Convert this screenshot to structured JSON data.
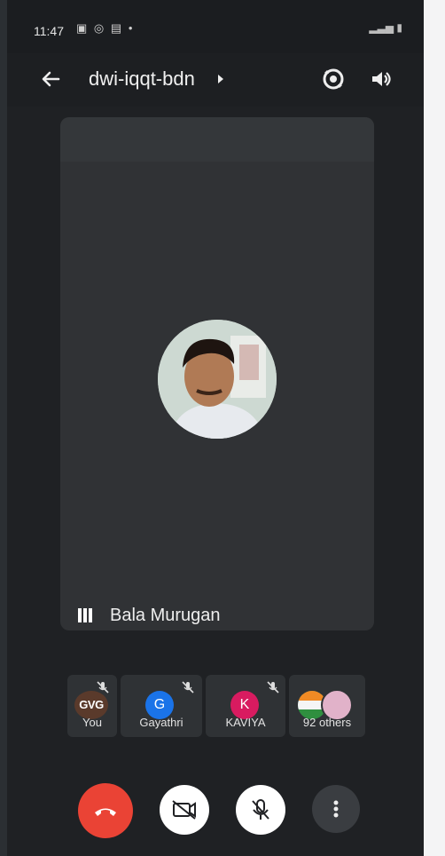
{
  "status_bar": {
    "time": "11:47",
    "dot": "•"
  },
  "app_bar": {
    "meeting_code": "dwi-iqqt-bdn"
  },
  "main_tile": {
    "name": "Bala Murugan"
  },
  "participants": [
    {
      "label": "You",
      "avatar": "GVG",
      "avatar_color": "#5a3a2b"
    },
    {
      "label": "Gayathri",
      "avatar": "G",
      "avatar_color": "#1a73e8"
    },
    {
      "label": "KAVIYA",
      "avatar": "K",
      "avatar_color": "#d81b60"
    },
    {
      "label": "92 others",
      "avatar": "",
      "avatar_color": "#e1b2c9"
    }
  ],
  "colors": {
    "end_call": "#ea4335",
    "background": "#1f2124",
    "tile": "#303235"
  }
}
